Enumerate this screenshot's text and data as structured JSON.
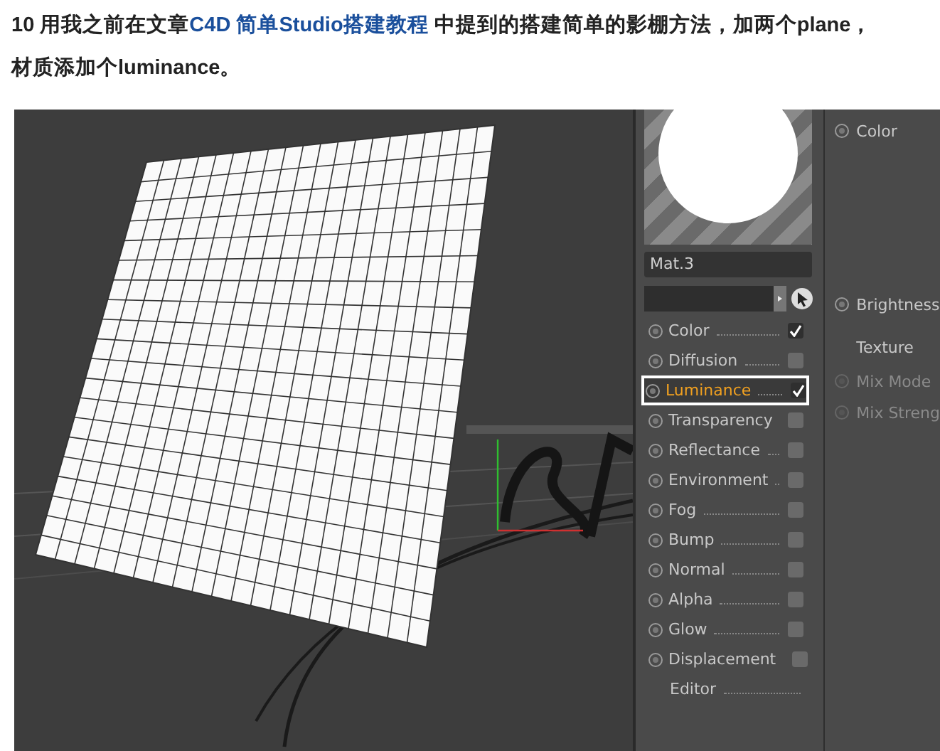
{
  "paragraph": {
    "before": "10 用我之前在文章",
    "link": "C4D 简单Studio搭建教程",
    "after": " 中提到的搭建简单的影棚方法，加两个plane，材质添加个luminance。"
  },
  "material": {
    "name": "Mat.3"
  },
  "channels": [
    {
      "kind": "channel",
      "label": "Color",
      "checked": true,
      "selected": false
    },
    {
      "kind": "channel",
      "label": "Diffusion",
      "checked": false,
      "selected": false
    },
    {
      "kind": "channel",
      "label": "Luminance",
      "checked": true,
      "selected": true
    },
    {
      "kind": "channel",
      "label": "Transparency",
      "checked": false,
      "selected": false
    },
    {
      "kind": "channel",
      "label": "Reflectance",
      "checked": false,
      "selected": false
    },
    {
      "kind": "channel",
      "label": "Environment",
      "checked": false,
      "selected": false
    },
    {
      "kind": "channel",
      "label": "Fog",
      "checked": false,
      "selected": false
    },
    {
      "kind": "channel",
      "label": "Bump",
      "checked": false,
      "selected": false
    },
    {
      "kind": "channel",
      "label": "Normal",
      "checked": false,
      "selected": false
    },
    {
      "kind": "channel",
      "label": "Alpha",
      "checked": false,
      "selected": false
    },
    {
      "kind": "channel",
      "label": "Glow",
      "checked": false,
      "selected": false
    },
    {
      "kind": "channel",
      "label": "Displacement",
      "checked": false,
      "selected": false
    },
    {
      "kind": "plain",
      "label": "Editor"
    }
  ],
  "attributes": {
    "color_label": "Color",
    "brightness_label": "Brightness",
    "texture_label": "Texture",
    "mix": [
      {
        "label": "Mix Mode",
        "disabled": true
      },
      {
        "label": "Mix Streng",
        "disabled": true
      }
    ]
  }
}
